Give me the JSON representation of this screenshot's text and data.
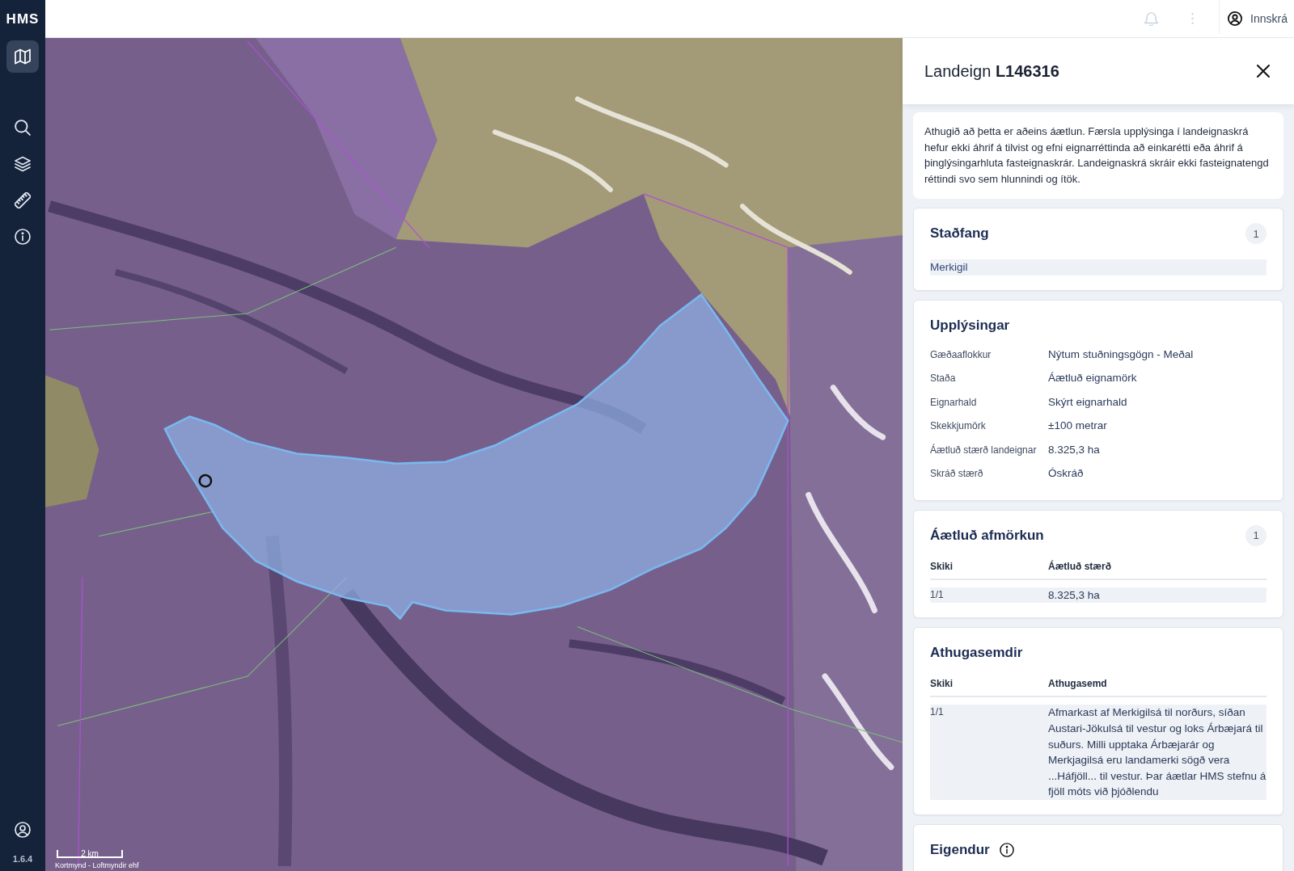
{
  "sidebar": {
    "logo": "HMS",
    "views": [
      {
        "selected": true
      }
    ],
    "tools": [
      {
        "selected": false
      },
      {
        "selected": false
      },
      {
        "selected": false
      },
      {
        "selected": false
      }
    ],
    "version": "1.6.4"
  },
  "topbar": {
    "login_label": "Innskrá"
  },
  "map": {
    "scale_label": "2 km",
    "attribution": "Kortmynd - Loftmyndir ehf"
  },
  "panel": {
    "title": "Landeign **L146316**",
    "notice": "Athugið að þetta er aðeins áætlun. Færsla upplýsinga í landeignaskrá hefur ekki áhrif á tilvist og efni eignarréttinda að einkarétti eða áhrif á þinglýsingarhluta fasteignaskrár. Landeignaskrá skráir ekki fasteignatengd réttindi svo sem hlunnindi og ítök.",
    "sections": [
      {
        "kind": "list",
        "title": "Staðfang",
        "count": "1",
        "items": [
          "Merkigil"
        ]
      },
      {
        "kind": "details",
        "title": "Upplýsingar",
        "rows": [
          {
            "label": "Gæðaaflokkur",
            "value": "Nýtum stuðningsgögn - Meðal"
          },
          {
            "label": "Staða",
            "value": "Áætluð eignamörk"
          },
          {
            "label": "Eignarhald",
            "value": "Skýrt eignarhald"
          },
          {
            "label": "Skekkjumörk",
            "value": "±100 metrar"
          },
          {
            "label": "Áætluð stærð landeignar",
            "value": "8.325,3 ha"
          },
          {
            "label": "Skráð stærð",
            "value": "Óskráð"
          }
        ]
      },
      {
        "kind": "table",
        "title": "Áætluð afmörkun",
        "count": "1",
        "columns": [
          "Skiki",
          "Áætluð stærð"
        ],
        "rows": [
          [
            "1/1",
            "8.325,3 ha"
          ]
        ]
      },
      {
        "kind": "table",
        "title": "Athugasemdir",
        "columns": [
          "Skiki",
          "Athugasemd"
        ],
        "rows": [
          [
            "1/1",
            "Afmarkast af Merkigilsá til norðurs, síðan Austari-Jökulsá til vestur og loks Árbæjará til suðurs. Milli upptaka Árbæjarár og Merkjagilsá eru landamerki sögð vera ...Háfjöll... til vestur. Þar áætlar HMS stefnu á fjöll móts við þjóðlendu"
          ]
        ]
      },
      {
        "kind": "heading",
        "title": "Eigendur",
        "info_icon": true
      }
    ]
  }
}
